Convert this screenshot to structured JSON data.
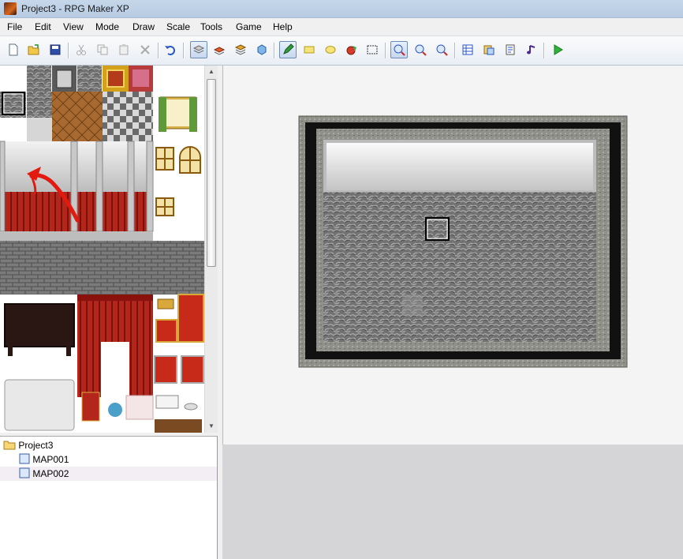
{
  "window": {
    "title": "Project3 - RPG Maker XP"
  },
  "menu": [
    "File",
    "Edit",
    "View",
    "Mode",
    "Draw",
    "Scale",
    "Tools",
    "Game",
    "Help"
  ],
  "toolbar": [
    {
      "name": "new-icon"
    },
    {
      "name": "open-icon"
    },
    {
      "name": "save-icon"
    },
    {
      "name": "cut-icon"
    },
    {
      "name": "copy-icon"
    },
    {
      "name": "paste-icon"
    },
    {
      "name": "delete-icon"
    },
    {
      "name": "undo-icon"
    },
    {
      "name": "layer1-icon",
      "active": true
    },
    {
      "name": "layer2-icon"
    },
    {
      "name": "layer3-icon"
    },
    {
      "name": "events-layer-icon"
    },
    {
      "name": "pencil-icon",
      "active": true
    },
    {
      "name": "rectangle-icon"
    },
    {
      "name": "ellipse-icon"
    },
    {
      "name": "flood-fill-icon"
    },
    {
      "name": "select-icon"
    },
    {
      "name": "zoom-1-1-icon",
      "active": true
    },
    {
      "name": "zoom-1-2-icon"
    },
    {
      "name": "zoom-1-4-icon"
    },
    {
      "name": "database-icon"
    },
    {
      "name": "materialbase-icon"
    },
    {
      "name": "script-editor-icon"
    },
    {
      "name": "sound-test-icon"
    },
    {
      "name": "playtest-icon"
    }
  ],
  "tree": {
    "root": "Project3",
    "maps": [
      "MAP001",
      "MAP002"
    ],
    "selected": "MAP002"
  },
  "colors": {
    "accent_red": "#e21a0f",
    "canvas_bg": "#f4f4f4",
    "tree_selected": "#f2eef3"
  }
}
